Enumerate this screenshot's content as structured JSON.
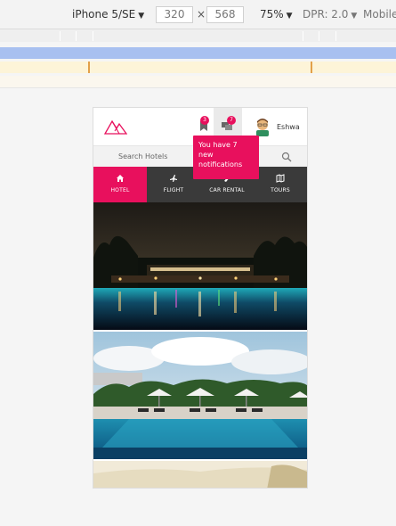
{
  "devtools": {
    "device": "iPhone 5/SE",
    "width": "320",
    "height": "568",
    "times": "×",
    "zoom": "75%",
    "dpr": "DPR: 2.0",
    "mobile": "Mobile"
  },
  "header": {
    "bookmark_badge": "3",
    "notification_badge": "7",
    "user_name": "Eshwa",
    "accent_color": "#e8105d"
  },
  "notification_tooltip": {
    "text": "You have 7 new notifications"
  },
  "search": {
    "placeholder": "Search Hotels"
  },
  "tabs": [
    {
      "label": "HOTEL",
      "icon": "home-icon",
      "active": true
    },
    {
      "label": "FLIGHT",
      "icon": "plane-icon",
      "active": false
    },
    {
      "label": "CAR RENTAL",
      "icon": "car-icon",
      "active": false
    },
    {
      "label": "TOURS",
      "icon": "map-icon",
      "active": false
    }
  ]
}
